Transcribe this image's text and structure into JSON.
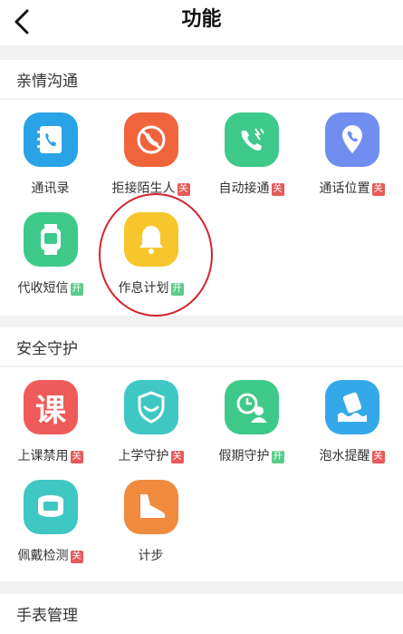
{
  "header": {
    "title": "功能"
  },
  "sections": [
    {
      "title": "亲情沟通",
      "items": [
        {
          "label": "通讯录",
          "badge": "",
          "icon": "contacts-book-icon",
          "color": "#2aa3e6"
        },
        {
          "label": "拒接陌生人",
          "badge": "关",
          "icon": "block-call-icon",
          "color": "#f0643c"
        },
        {
          "label": "自动接通",
          "badge": "关",
          "icon": "auto-answer-icon",
          "color": "#3ec98a"
        },
        {
          "label": "通话位置",
          "badge": "关",
          "icon": "call-location-icon",
          "color": "#6f8ef0"
        },
        {
          "label": "代收短信",
          "badge": "开",
          "icon": "watch-sms-icon",
          "color": "#3ec98a"
        },
        {
          "label": "作息计划",
          "badge": "开",
          "icon": "bell-icon",
          "color": "#f7c62c"
        }
      ]
    },
    {
      "title": "安全守护",
      "items": [
        {
          "label": "上课禁用",
          "badge": "关",
          "icon": "class-character-icon",
          "glyph": "课",
          "color": "#ef5a5a"
        },
        {
          "label": "上学守护",
          "badge": "关",
          "icon": "shield-smile-icon",
          "color": "#3fc7c3"
        },
        {
          "label": "假期守护",
          "badge": "开",
          "icon": "holiday-guard-icon",
          "color": "#3ec98a"
        },
        {
          "label": "泡水提醒",
          "badge": "关",
          "icon": "water-alert-icon",
          "color": "#35a8ea"
        },
        {
          "label": "佩戴检测",
          "badge": "关",
          "icon": "wear-detect-icon",
          "color": "#3fc7c3"
        },
        {
          "label": "计步",
          "badge": "",
          "icon": "shoe-step-icon",
          "color": "#f08a3c"
        }
      ]
    },
    {
      "title": "手表管理",
      "items": []
    }
  ]
}
